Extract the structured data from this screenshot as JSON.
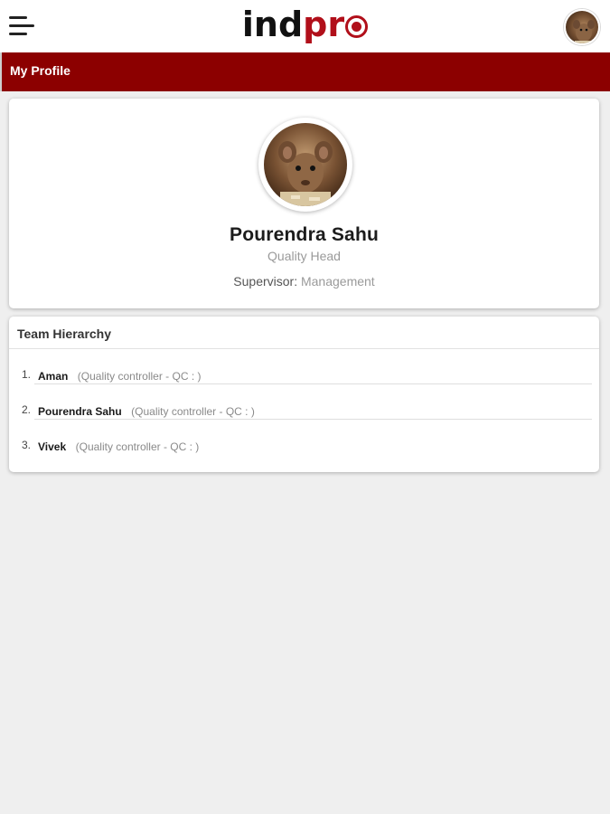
{
  "header": {
    "logo_dark": "ind",
    "logo_red": "pr",
    "menu_icon": "hamburger-menu-icon",
    "avatar_icon": "user-avatar-icon",
    "brand_color": "#b10f1a"
  },
  "titlebar": {
    "title": "My Profile",
    "color": "#8c0000"
  },
  "profile": {
    "name": "Pourendra Sahu",
    "role": "Quality Head",
    "supervisor_label": "Supervisor:",
    "supervisor_value": "Management"
  },
  "team": {
    "title": "Team Hierarchy",
    "members": [
      {
        "index": "1.",
        "name": "Aman",
        "role": "(Quality controller - QC : )"
      },
      {
        "index": "2.",
        "name": "Pourendra Sahu",
        "role": "(Quality controller - QC : )"
      },
      {
        "index": "3.",
        "name": "Vivek",
        "role": "(Quality controller - QC : )"
      }
    ]
  }
}
